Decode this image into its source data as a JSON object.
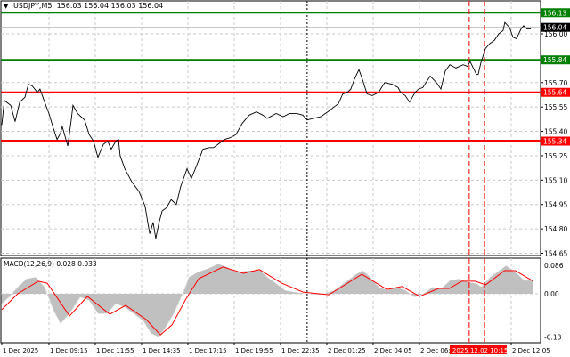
{
  "header": {
    "symbol": "USDJPY,M5",
    "open": "156.03",
    "high": "156.04",
    "low": "156.03",
    "close": "156.04"
  },
  "macd_header": {
    "label": "MACD(12,26,9)",
    "main": "0.028",
    "signal": "0.033"
  },
  "colors": {
    "support_green": "#008000",
    "level_red": "#ff0000",
    "price_line": "#000000",
    "histogram": "#c0c0c0",
    "signal": "#ff0000",
    "current_label_bg": "#000000"
  },
  "chart_data": [
    {
      "type": "line",
      "title": "USDJPY,M5",
      "xlabel": "",
      "ylabel": "",
      "x_units": "minutes from chart start",
      "xlim": [
        0,
        1840
      ],
      "ylim": [
        154.59,
        156.21
      ],
      "grid": true,
      "y_ticks": [
        "156.00",
        "155.70",
        "155.55",
        "155.40",
        "155.25",
        "155.10",
        "154.95",
        "154.80",
        "154.65"
      ],
      "x_ticks": [
        {
          "t": 0,
          "label": "1 Dec 2025"
        },
        {
          "t": 163,
          "label": "1 Dec 09:15"
        },
        {
          "t": 323,
          "label": "1 Dec 11:55"
        },
        {
          "t": 483,
          "label": "1 Dec 14:35"
        },
        {
          "t": 643,
          "label": "1 Dec 17:15"
        },
        {
          "t": 803,
          "label": "1 Dec 19:55"
        },
        {
          "t": 963,
          "label": "1 Dec 22:35"
        },
        {
          "t": 1123,
          "label": "2 Dec 01:25"
        },
        {
          "t": 1283,
          "label": "2 Dec 04:05"
        },
        {
          "t": 1443,
          "label": "2 Dec 06:45"
        },
        {
          "t": 1760,
          "label": "2 Dec 12:05"
        }
      ],
      "crosshair_time_label": {
        "t": 1646,
        "label": "2025.12.02 10:15"
      },
      "levels": [
        {
          "price": "156.13",
          "color": "#008000",
          "width": "thin"
        },
        {
          "price": "155.84",
          "color": "#008000",
          "width": "thin"
        },
        {
          "price": "155.64",
          "color": "#ff0000",
          "width": "thin"
        },
        {
          "price": "155.34",
          "color": "#ff0000",
          "width": "thick"
        }
      ],
      "current_price": "156.04",
      "day_separator_t": 1055,
      "marker_lines_t": [
        1615,
        1668
      ],
      "series": [
        {
          "name": "USDJPY close",
          "points": [
            [
              0,
              155.44
            ],
            [
              9,
              155.59
            ],
            [
              31,
              155.56
            ],
            [
              46,
              155.46
            ],
            [
              62,
              155.58
            ],
            [
              80,
              155.61
            ],
            [
              92,
              155.69
            ],
            [
              105,
              155.68
            ],
            [
              123,
              155.64
            ],
            [
              132,
              155.66
            ],
            [
              148,
              155.58
            ],
            [
              163,
              155.51
            ],
            [
              178,
              155.42
            ],
            [
              191,
              155.35
            ],
            [
              203,
              155.39
            ],
            [
              209,
              155.43
            ],
            [
              228,
              155.31
            ],
            [
              240,
              155.47
            ],
            [
              246,
              155.56
            ],
            [
              262,
              155.51
            ],
            [
              286,
              155.47
            ],
            [
              302,
              155.38
            ],
            [
              317,
              155.34
            ],
            [
              332,
              155.24
            ],
            [
              351,
              155.32
            ],
            [
              366,
              155.34
            ],
            [
              378,
              155.29
            ],
            [
              394,
              155.34
            ],
            [
              403,
              155.35
            ],
            [
              409,
              155.25
            ],
            [
              425,
              155.17
            ],
            [
              449,
              155.09
            ],
            [
              474,
              155.03
            ],
            [
              495,
              154.94
            ],
            [
              511,
              154.77
            ],
            [
              523,
              154.84
            ],
            [
              532,
              154.74
            ],
            [
              542,
              154.83
            ],
            [
              554,
              154.91
            ],
            [
              569,
              154.93
            ],
            [
              585,
              154.98
            ],
            [
              603,
              154.95
            ],
            [
              618,
              155.06
            ],
            [
              640,
              155.17
            ],
            [
              655,
              155.11
            ],
            [
              671,
              155.18
            ],
            [
              695,
              155.29
            ],
            [
              717,
              155.3
            ],
            [
              732,
              155.3
            ],
            [
              754,
              155.33
            ],
            [
              769,
              155.35
            ],
            [
              788,
              155.36
            ],
            [
              809,
              155.38
            ],
            [
              831,
              155.45
            ],
            [
              855,
              155.5
            ],
            [
              880,
              155.52
            ],
            [
              902,
              155.5
            ],
            [
              917,
              155.48
            ],
            [
              948,
              155.51
            ],
            [
              972,
              155.49
            ],
            [
              994,
              155.51
            ],
            [
              1018,
              155.51
            ],
            [
              1040,
              155.5
            ],
            [
              1055,
              155.47
            ],
            [
              1077,
              155.48
            ],
            [
              1102,
              155.49
            ],
            [
              1126,
              155.52
            ],
            [
              1148,
              155.55
            ],
            [
              1163,
              155.57
            ],
            [
              1178,
              155.63
            ],
            [
              1194,
              155.64
            ],
            [
              1206,
              155.66
            ],
            [
              1218,
              155.72
            ],
            [
              1234,
              155.78
            ],
            [
              1246,
              155.72
            ],
            [
              1262,
              155.63
            ],
            [
              1280,
              155.62
            ],
            [
              1302,
              155.64
            ],
            [
              1323,
              155.7
            ],
            [
              1348,
              155.69
            ],
            [
              1369,
              155.67
            ],
            [
              1378,
              155.64
            ],
            [
              1394,
              155.62
            ],
            [
              1409,
              155.58
            ],
            [
              1428,
              155.64
            ],
            [
              1440,
              155.66
            ],
            [
              1455,
              155.67
            ],
            [
              1480,
              155.74
            ],
            [
              1502,
              155.7
            ],
            [
              1517,
              155.66
            ],
            [
              1532,
              155.77
            ],
            [
              1548,
              155.81
            ],
            [
              1569,
              155.79
            ],
            [
              1594,
              155.81
            ],
            [
              1609,
              155.8
            ],
            [
              1618,
              155.83
            ],
            [
              1640,
              155.75
            ],
            [
              1646,
              155.75
            ],
            [
              1655,
              155.82
            ],
            [
              1671,
              155.91
            ],
            [
              1686,
              155.94
            ],
            [
              1702,
              155.96
            ],
            [
              1717,
              156.0
            ],
            [
              1732,
              156.02
            ],
            [
              1738,
              156.07
            ],
            [
              1754,
              156.04
            ],
            [
              1766,
              155.98
            ],
            [
              1778,
              155.97
            ],
            [
              1794,
              156.03
            ],
            [
              1803,
              156.05
            ],
            [
              1815,
              156.03
            ],
            [
              1828,
              156.03
            ]
          ]
        }
      ]
    },
    {
      "type": "bar",
      "title": "MACD(12,26,9)",
      "x_units": "minutes from chart start",
      "xlim": [
        0,
        1840
      ],
      "ylim": [
        -0.13,
        0.086
      ],
      "y_ticks": [
        "0.086",
        "0.00",
        "-0.13"
      ],
      "series": [
        {
          "name": "MACD histogram",
          "points": [
            [
              0,
              -0.03
            ],
            [
              25,
              -0.01
            ],
            [
              55,
              0.02
            ],
            [
              86,
              0.045
            ],
            [
              117,
              0.05
            ],
            [
              148,
              0.02
            ],
            [
              179,
              -0.05
            ],
            [
              203,
              -0.09
            ],
            [
              234,
              -0.06
            ],
            [
              271,
              -0.01
            ],
            [
              302,
              -0.02
            ],
            [
              333,
              -0.06
            ],
            [
              363,
              -0.06
            ],
            [
              394,
              -0.03
            ],
            [
              425,
              -0.04
            ],
            [
              456,
              -0.06
            ],
            [
              487,
              -0.08
            ],
            [
              517,
              -0.12
            ],
            [
              542,
              -0.13
            ],
            [
              567,
              -0.1
            ],
            [
              594,
              -0.06
            ],
            [
              625,
              0.0
            ],
            [
              647,
              0.05
            ],
            [
              677,
              0.065
            ],
            [
              718,
              0.078
            ],
            [
              748,
              0.09
            ],
            [
              779,
              0.08
            ],
            [
              810,
              0.065
            ],
            [
              856,
              0.07
            ],
            [
              893,
              0.07
            ],
            [
              918,
              0.05
            ],
            [
              949,
              0.03
            ],
            [
              979,
              0.01
            ],
            [
              1010,
              0.005
            ],
            [
              1056,
              0.0
            ],
            [
              1103,
              -0.003
            ],
            [
              1149,
              0.01
            ],
            [
              1195,
              0.04
            ],
            [
              1226,
              0.06
            ],
            [
              1247,
              0.07
            ],
            [
              1272,
              0.05
            ],
            [
              1303,
              0.02
            ],
            [
              1334,
              0.01
            ],
            [
              1364,
              0.02
            ],
            [
              1395,
              0.01
            ],
            [
              1426,
              -0.01
            ],
            [
              1457,
              0.0
            ],
            [
              1488,
              0.02
            ],
            [
              1518,
              0.015
            ],
            [
              1549,
              0.04
            ],
            [
              1580,
              0.045
            ],
            [
              1611,
              0.035
            ],
            [
              1642,
              0.03
            ],
            [
              1657,
              0.02
            ],
            [
              1688,
              0.05
            ],
            [
              1719,
              0.07
            ],
            [
              1743,
              0.085
            ],
            [
              1774,
              0.065
            ],
            [
              1805,
              0.04
            ],
            [
              1836,
              0.04
            ]
          ]
        },
        {
          "name": "Signal",
          "type": "line",
          "points": [
            [
              0,
              -0.048
            ],
            [
              55,
              0.0
            ],
            [
              126,
              0.038
            ],
            [
              157,
              0.032
            ],
            [
              234,
              -0.067
            ],
            [
              296,
              -0.008
            ],
            [
              373,
              -0.062
            ],
            [
              428,
              -0.035
            ],
            [
              499,
              -0.078
            ],
            [
              548,
              -0.124
            ],
            [
              588,
              -0.094
            ],
            [
              638,
              -0.013
            ],
            [
              681,
              0.046
            ],
            [
              764,
              0.081
            ],
            [
              835,
              0.062
            ],
            [
              890,
              0.073
            ],
            [
              967,
              0.032
            ],
            [
              1041,
              0.005
            ],
            [
              1130,
              -0.003
            ],
            [
              1244,
              0.059
            ],
            [
              1331,
              0.013
            ],
            [
              1383,
              0.022
            ],
            [
              1444,
              -0.008
            ],
            [
              1509,
              0.016
            ],
            [
              1546,
              0.016
            ],
            [
              1589,
              0.038
            ],
            [
              1635,
              0.038
            ],
            [
              1672,
              0.027
            ],
            [
              1737,
              0.07
            ],
            [
              1774,
              0.07
            ],
            [
              1836,
              0.038
            ]
          ]
        }
      ]
    }
  ]
}
